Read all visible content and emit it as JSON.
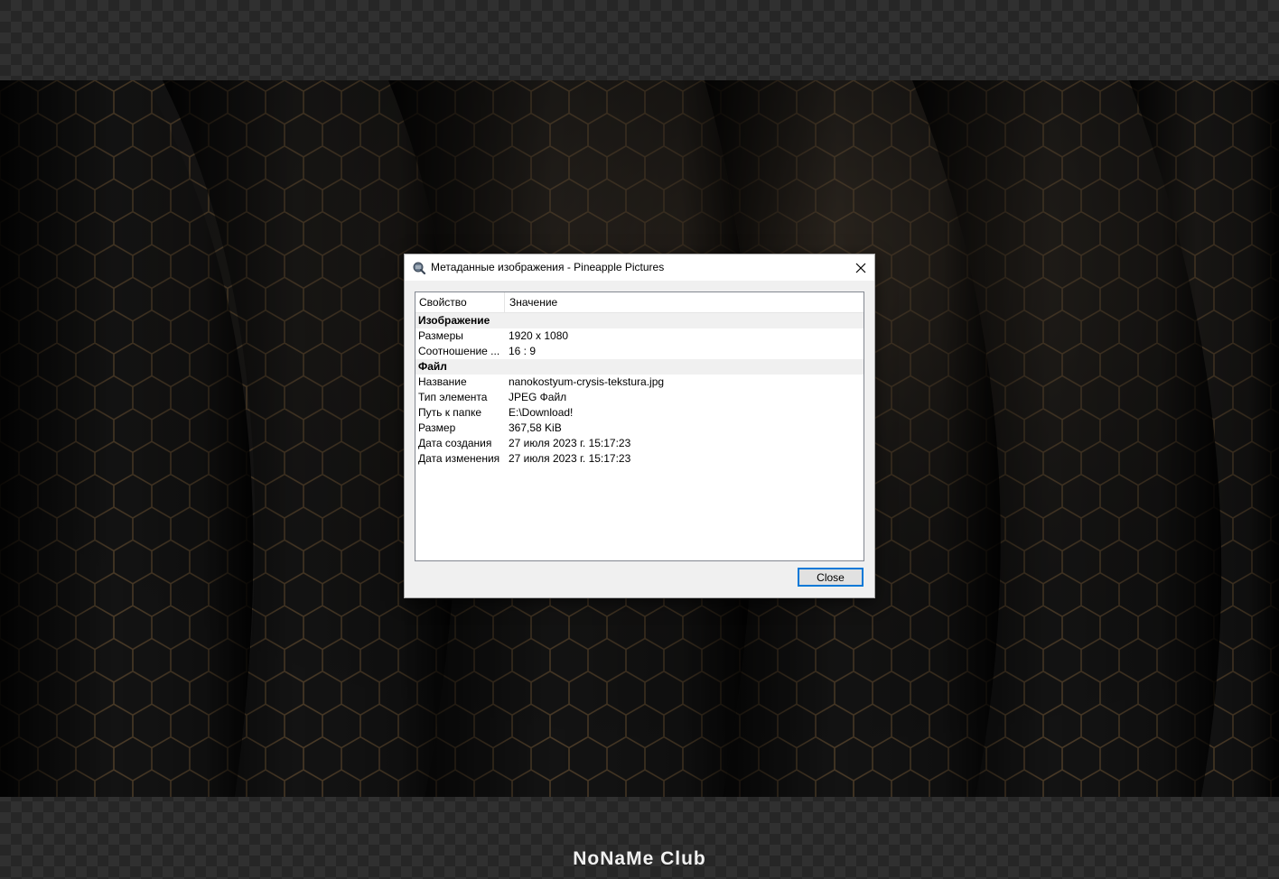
{
  "dialog": {
    "title": "Метаданные изображения - Pineapple Pictures",
    "app_icon": "pineapple-icon",
    "close_icon": "close-icon",
    "columns": {
      "property": "Свойство",
      "value": "Значение"
    },
    "groups": [
      {
        "label": "Изображение",
        "rows": [
          {
            "key": "Размеры",
            "value": "1920 x 1080"
          },
          {
            "key": "Соотношение ...",
            "value": "16 : 9"
          }
        ]
      },
      {
        "label": "Файл",
        "rows": [
          {
            "key": "Название",
            "value": "nanokostyum-crysis-tekstura.jpg"
          },
          {
            "key": "Тип элемента",
            "value": "JPEG Файл"
          },
          {
            "key": "Путь к папке",
            "value": "E:\\Download!"
          },
          {
            "key": "Размер",
            "value": "367,58 KiB"
          },
          {
            "key": "Дата создания",
            "value": "27 июля 2023 г. 15:17:23"
          },
          {
            "key": "Дата изменения",
            "value": "27 июля 2023 г. 15:17:23"
          }
        ]
      }
    ],
    "close_button": "Close"
  },
  "watermark": "NoNaMe Club",
  "colors": {
    "accent": "#0078d7",
    "hex_line": "#a07a4a",
    "backdrop": "#262626"
  }
}
